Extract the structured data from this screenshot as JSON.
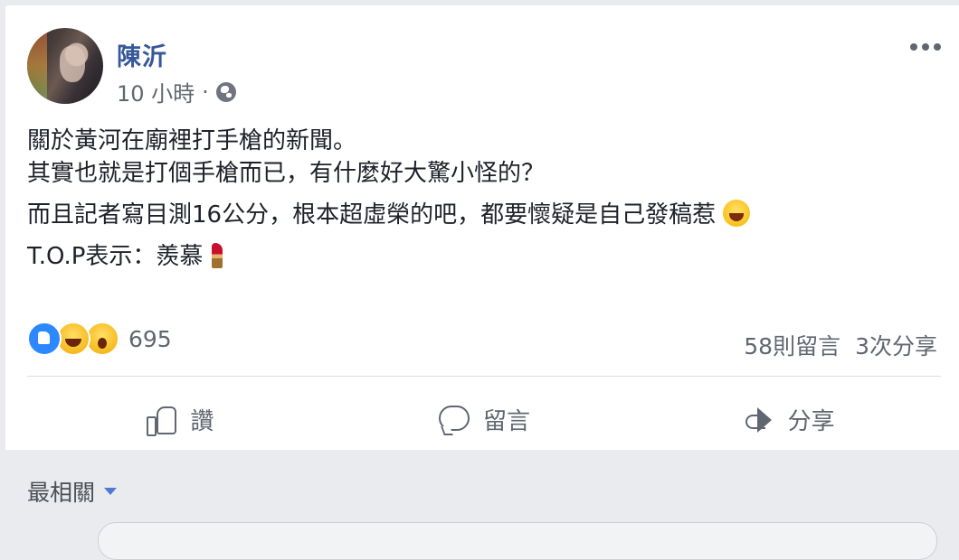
{
  "post": {
    "author": "陳沂",
    "time": "10 小時",
    "separator": "·",
    "lines": [
      "關於黃河在廟裡打手槍的新聞。",
      "其實也就是打個手槍而已，有什麼好大驚小怪的？",
      "而且記者寫目測16公分，根本超虛榮的吧，都要懷疑是自己發稿惹",
      "T.O.P表示：羨慕"
    ]
  },
  "icons": {
    "privacy": "globe-icon",
    "more": "more-options-icon",
    "emoji_line3": "laughing-tears-emoji",
    "emoji_line4": "lipstick-emoji",
    "reactions": [
      "like-reaction-icon",
      "haha-reaction-icon",
      "wow-reaction-icon"
    ]
  },
  "engagement": {
    "reaction_count": "695",
    "comments": "58則留言",
    "shares": "3次分享"
  },
  "actions": {
    "like": "讚",
    "comment": "留言",
    "share": "分享"
  },
  "comments_section": {
    "sort_label": "最相關"
  },
  "colors": {
    "author_link": "#365899",
    "like_blue": "#2d88ff",
    "muted_text": "#616770"
  }
}
